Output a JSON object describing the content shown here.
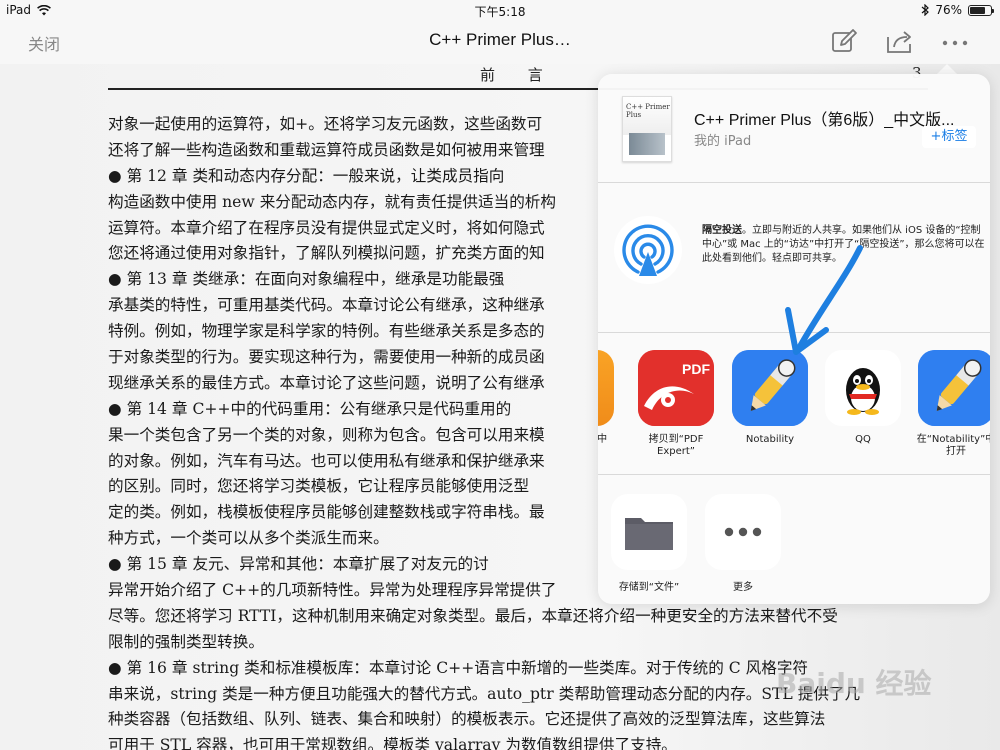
{
  "status_bar": {
    "device": "iPad",
    "time": "下午5:18",
    "battery_text": "76%",
    "battery_level": 0.76
  },
  "nav": {
    "close_label": "关闭",
    "title": "C++ Primer Plus…",
    "icons": [
      "edit-icon",
      "share-icon",
      "more-icon"
    ]
  },
  "document": {
    "header": "前 言",
    "page_number": "3",
    "lines": [
      "对象一起使用的运算符，如+。还将学习友元函数，这些函数可",
      "还将了解一些构造函数和重载运算符成员函数是如何被用来管理",
      "    ●   第 12 章   类和动态内存分配：一般来说，让类成员指向",
      "构造函数中使用 new 来分配动态内存，就有责任提供适当的析构",
      "运算符。本章介绍了在程序员没有提供显式定义时，将如何隐式",
      "您还将通过使用对象指针，了解队列模拟问题，扩充类方面的知",
      "    ●   第 13 章   类继承：在面向对象编程中，继承是功能最强",
      "承基类的特性，可重用基类代码。本章讨论公有继承，这种继承",
      "特例。例如，物理学家是科学家的特例。有些继承关系是多态的",
      "于对象类型的行为。要实现这种行为，需要使用一种新的成员函",
      "现继承关系的最佳方式。本章讨论了这些问题，说明了公有继承",
      "    ●   第 14 章   C++中的代码重用：公有继承只是代码重用的",
      "果一个类包含了另一个类的对象，则称为包含。包含可以用来模",
      "的对象。例如，汽车有马达。也可以使用私有继承和保护继承来",
      "的区别。同时，您还将学习类模板，它让程序员能够使用泛型",
      "定的类。例如，栈模板使程序员能够创建整数栈或字符串栈。最",
      "种方式，一个类可以从多个类派生而来。",
      "    ●   第 15 章   友元、异常和其他：本章扩展了对友元的讨",
      "异常开始介绍了 C++的几项新特性。异常为处理程序异常提供了",
      "尽等。您还将学习 RTTI，这种机制用来确定对象类型。最后，本章还将介绍一种更安全的方法来替代不受",
      "限制的强制类型转换。",
      "    ●   第 16 章   string 类和标准模板库：本章讨论 C++语言中新增的一些类库。对于传统的 C 风格字符",
      "串来说，string 类是一种方便且功能强大的替代方式。auto_ptr 类帮助管理动态分配的内存。STL 提供了几",
      "种类容器（包括数组、队列、链表、集合和映射）的模板表示。它还提供了高效的泛型算法库，这些算法",
      "可用于 STL 容器，也可用于常规数组。模板类 valarray 为数值数组提供了支持。"
    ]
  },
  "share_sheet": {
    "file": {
      "name": "C++ Primer Plus（第6版）_中文版...",
      "location": "我的 iPad",
      "tag_button": "+标签",
      "cover_text": "C++ Primer Plus"
    },
    "airdrop": {
      "title": "隔空投送",
      "description": "。立即与附近的人共享。如果他们从 iOS 设备的“控制中心”或 Mac 上的“访达”中打开了“隔空投送”，那么您将可以在此处看到他们。轻点即可共享。"
    },
    "apps": [
      {
        "label": "“中",
        "icon": "app-partial-orange-icon"
      },
      {
        "label": "拷贝到“PDF Expert”",
        "icon": "pdf-expert-icon",
        "badge": "PDF"
      },
      {
        "label": "Notability",
        "icon": "notability-icon"
      },
      {
        "label": "QQ",
        "icon": "qq-penguin-icon"
      },
      {
        "label": "在“Notability”中打开",
        "icon": "notability-icon"
      }
    ],
    "actions": [
      {
        "label": "存储到“文件”",
        "icon": "folder-icon"
      },
      {
        "label": "更多",
        "icon": "more-icon"
      }
    ]
  },
  "watermark": "Baidu 经验",
  "colors": {
    "accent_blue": "#1a7ee6",
    "notability_blue": "#2f7ff0",
    "pdf_red": "#e2302c",
    "annotation_arrow": "#1e7fe0"
  }
}
